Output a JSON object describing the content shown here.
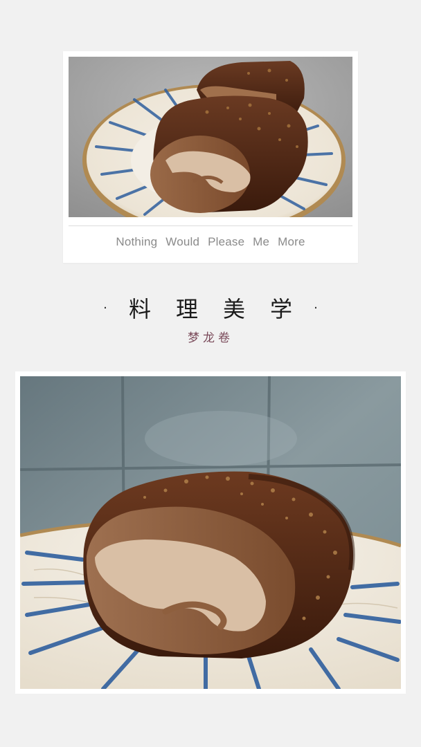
{
  "top_card": {
    "caption": "Nothing Would Please Me More"
  },
  "heading": {
    "dot_left": "·",
    "title": "料理美学",
    "dot_right": "·",
    "subtitle": "梦龙卷"
  },
  "colors": {
    "background": "#f1f1f1",
    "card": "#ffffff",
    "title": "#1b1b1b",
    "subtitle": "#7a4a5a",
    "caption": "#8a8a8a",
    "chocolate": "#4a2414",
    "sponge": "#8a5a3a",
    "cream": "#d9bfa5",
    "plate_blue": "#2f5f9e"
  }
}
